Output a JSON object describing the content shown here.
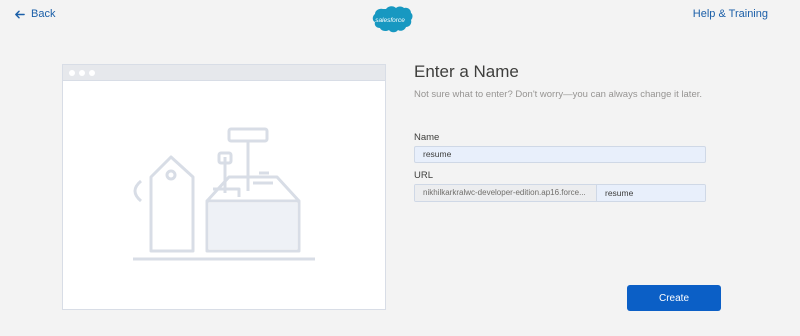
{
  "header": {
    "back_label": "Back",
    "logo_text": "salesforce",
    "help_label": "Help & Training"
  },
  "form": {
    "title": "Enter a Name",
    "subtitle": "Not sure what to enter? Don't worry—you can always change it later.",
    "name_label": "Name",
    "name_value": "resume",
    "url_label": "URL",
    "url_prefix": "nikhilkarkralwc-developer-edition.ap16.force...",
    "url_value": "resume"
  },
  "actions": {
    "create_label": "Create"
  },
  "colors": {
    "accent": "#0b5fc6",
    "link": "#1b5fa8",
    "input_bg": "#e8effb"
  }
}
